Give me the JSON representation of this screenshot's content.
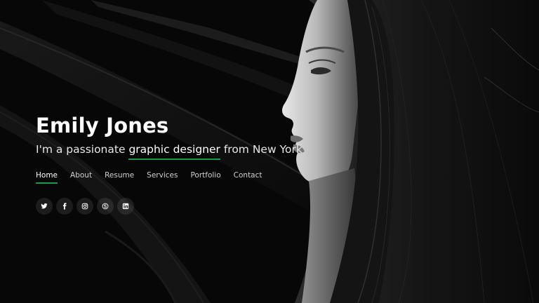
{
  "hero": {
    "name": "Emily Jones",
    "tagline_prefix": "I'm a passionate ",
    "tagline_highlight": "graphic designer",
    "tagline_suffix": " from New York"
  },
  "nav": {
    "items": [
      {
        "label": "Home",
        "active": true
      },
      {
        "label": "About",
        "active": false
      },
      {
        "label": "Resume",
        "active": false
      },
      {
        "label": "Services",
        "active": false
      },
      {
        "label": "Portfolio",
        "active": false
      },
      {
        "label": "Contact",
        "active": false
      }
    ]
  },
  "social": {
    "icons": [
      "twitter-icon",
      "facebook-icon",
      "instagram-icon",
      "skype-icon",
      "linkedin-icon"
    ]
  },
  "colors": {
    "accent": "#149c4a",
    "background": "#060606",
    "text": "#ffffff"
  }
}
